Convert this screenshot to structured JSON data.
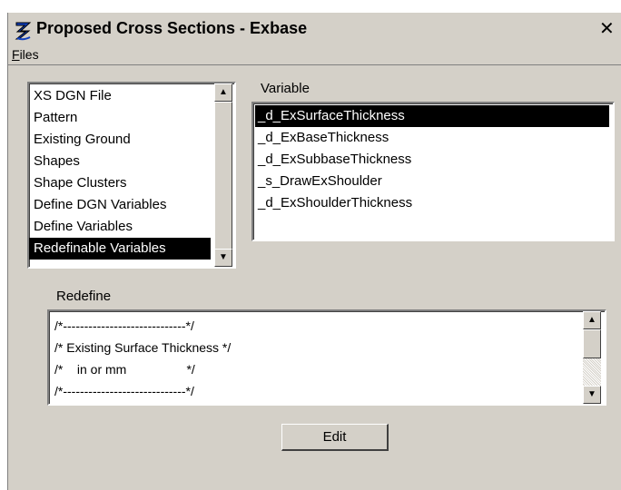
{
  "window": {
    "title": "Proposed Cross Sections - Exbase",
    "close_glyph": "✕",
    "icon": "exbase-app-icon"
  },
  "menu": {
    "files_label": "Files",
    "files_underline": "F",
    "files_rest": "iles"
  },
  "categories": {
    "items": [
      {
        "label": "XS DGN File",
        "selected": false
      },
      {
        "label": "Pattern",
        "selected": false
      },
      {
        "label": "Existing Ground",
        "selected": false
      },
      {
        "label": "Shapes",
        "selected": false
      },
      {
        "label": "Shape Clusters",
        "selected": false
      },
      {
        "label": "Define DGN Variables",
        "selected": false
      },
      {
        "label": "Define Variables",
        "selected": false
      },
      {
        "label": "Redefinable Variables",
        "selected": true
      }
    ]
  },
  "variables": {
    "label": "Variable",
    "items": [
      {
        "label": "_d_ExSurfaceThickness",
        "selected": true
      },
      {
        "label": "_d_ExBaseThickness",
        "selected": false
      },
      {
        "label": "_d_ExSubbaseThickness",
        "selected": false
      },
      {
        "label": "_s_DrawExShoulder",
        "selected": false
      },
      {
        "label": "_d_ExShoulderThickness",
        "selected": false
      }
    ]
  },
  "redefine": {
    "label": "Redefine",
    "lines": [
      "/*-----------------------------*/",
      "/* Existing Surface Thickness */",
      "/*    in or mm                 */",
      "/*-----------------------------*/"
    ]
  },
  "buttons": {
    "edit_label": "Edit"
  },
  "colors": {
    "dialog_bg": "#d4d0c8",
    "selection_bg": "#000000",
    "selection_fg": "#ffffff"
  }
}
